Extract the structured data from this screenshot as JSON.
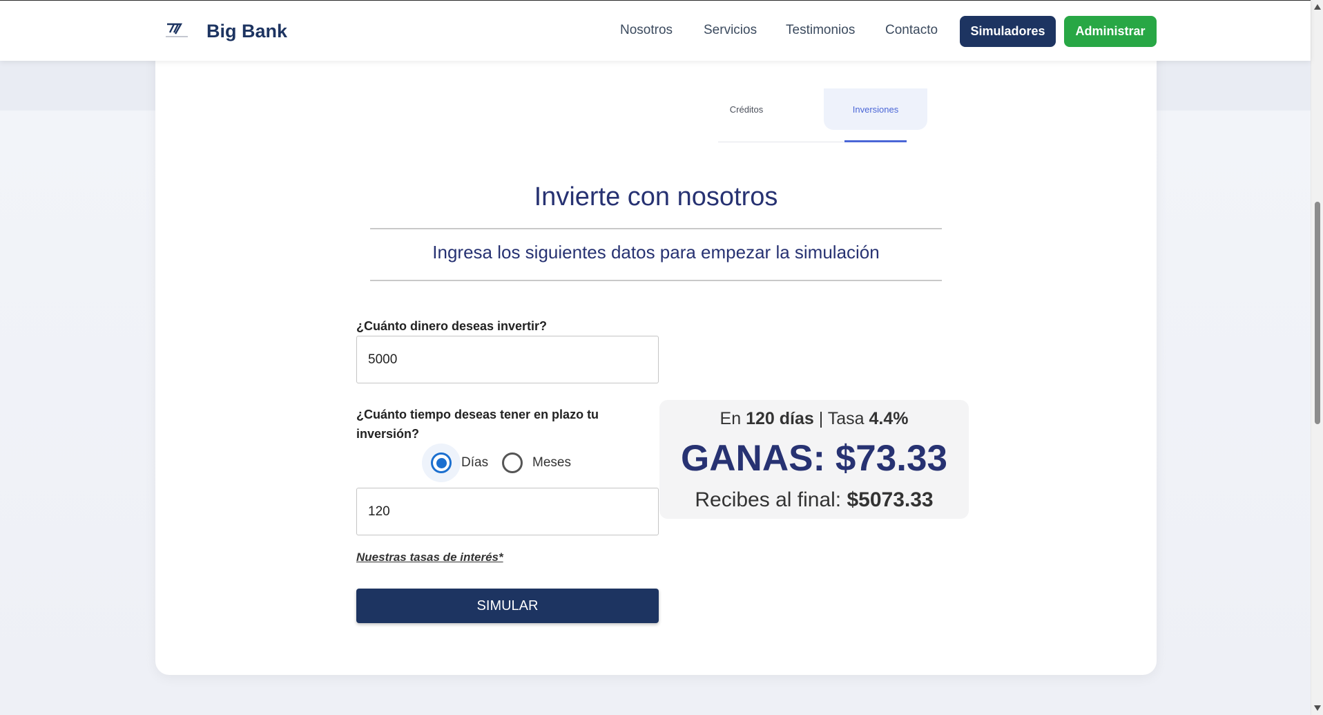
{
  "navbar": {
    "brand": "Big Bank",
    "links": [
      "Nosotros",
      "Servicios",
      "Testimonios",
      "Contacto"
    ],
    "simuladores_label": "Simuladores",
    "administrar_label": "Administrar",
    "colors": {
      "primary": "#1d3461",
      "success": "#28a745"
    }
  },
  "tabs": {
    "items": [
      "Créditos",
      "Inversiones"
    ],
    "active": "Inversiones"
  },
  "form": {
    "title": "Invierte con nosotros",
    "subtitle": "Ingresa los siguientes datos para empezar la simulación",
    "amount_label": "¿Cuánto dinero deseas invertir?",
    "amount_value": "5000",
    "term_label": "¿Cuánto tiempo deseas tener en plazo tu inversión?",
    "unit_options": [
      "Días",
      "Meses"
    ],
    "unit_selected": "Días",
    "term_value": "120",
    "rates_link": "Nuestras tasas de interés*",
    "submit_label": "SIMULAR"
  },
  "result": {
    "prefix": "En",
    "term": "120 días",
    "rate_prefix": "| Tasa",
    "rate": "4.4%",
    "gain": "GANAS: $73.33",
    "final_prefix": "Recibes al final:",
    "final_value": "$5073.33"
  }
}
